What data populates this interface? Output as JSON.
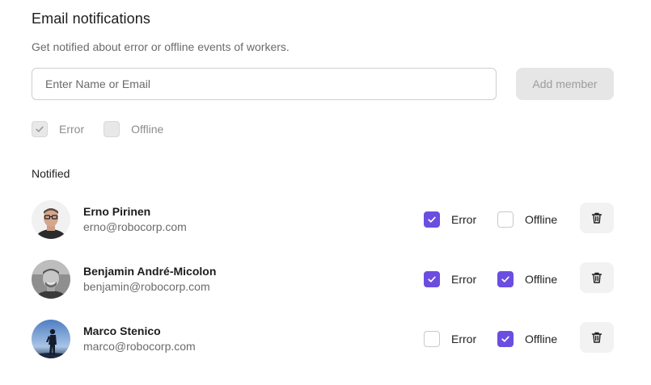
{
  "header": {
    "title": "Email notifications",
    "subtitle": "Get notified about error or offline events of workers."
  },
  "add_form": {
    "input_placeholder": "Enter Name or Email",
    "input_value": "",
    "add_button_label": "Add member",
    "add_button_disabled": true
  },
  "filters": [
    {
      "label": "Error",
      "checked": true,
      "disabled": true
    },
    {
      "label": "Offline",
      "checked": false,
      "disabled": true
    }
  ],
  "section_label": "Notified",
  "members": [
    {
      "name": "Erno Pirinen",
      "email": "erno@robocorp.com",
      "error_label": "Error",
      "error_checked": true,
      "offline_label": "Offline",
      "offline_checked": false,
      "avatar": "person-glasses-avatar"
    },
    {
      "name": "Benjamin André-Micolon",
      "email": "benjamin@robocorp.com",
      "error_label": "Error",
      "error_checked": true,
      "offline_label": "Offline",
      "offline_checked": true,
      "avatar": "person-bw-avatar"
    },
    {
      "name": "Marco Stenico",
      "email": "marco@robocorp.com",
      "error_label": "Error",
      "error_checked": false,
      "offline_label": "Offline",
      "offline_checked": true,
      "avatar": "silhouette-sky-avatar"
    }
  ],
  "colors": {
    "accent": "#6b4ee0",
    "disabled_button_bg": "#e6e6e6",
    "delete_button_bg": "#f2f2f2"
  },
  "icons": {
    "check": "check-icon",
    "delete": "trash-icon"
  }
}
